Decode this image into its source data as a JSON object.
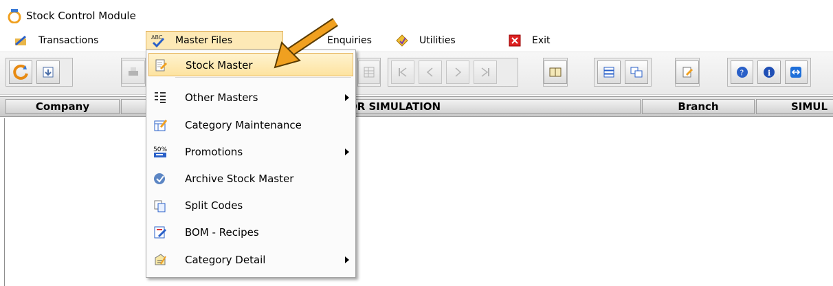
{
  "window": {
    "title": "Stock Control Module"
  },
  "menubar": {
    "items": [
      {
        "label": "Transactions",
        "icon": "transactions-icon"
      },
      {
        "label": "Master Files",
        "icon": "abc-check-icon"
      },
      {
        "label": "Enquiries",
        "icon": "enquiries-icon"
      },
      {
        "label": "Utilities",
        "icon": "utilities-icon"
      },
      {
        "label": "Exit",
        "icon": "close-icon"
      }
    ]
  },
  "header": {
    "company_label": "Company",
    "company_value": "LIQUOR SIMULATION",
    "branch_label": "Branch",
    "branch_value": "SIMUL"
  },
  "dropdown": {
    "items": [
      {
        "label": "Stock Master",
        "icon": "stock-master-icon",
        "submenu": false
      },
      {
        "label": "Other Masters",
        "icon": "list-icon",
        "submenu": true
      },
      {
        "label": "Category Maintenance",
        "icon": "category-icon",
        "submenu": false
      },
      {
        "label": "Promotions",
        "icon": "percent-icon",
        "submenu": true
      },
      {
        "label": "Archive Stock Master",
        "icon": "archive-icon",
        "submenu": false
      },
      {
        "label": "Split Codes",
        "icon": "split-icon",
        "submenu": false
      },
      {
        "label": "BOM - Recipes",
        "icon": "recipe-icon",
        "submenu": false
      },
      {
        "label": "Category Detail",
        "icon": "detail-icon",
        "submenu": true
      }
    ]
  },
  "colors": {
    "highlight": "#fde3a0",
    "arrow": "#f0a020"
  }
}
